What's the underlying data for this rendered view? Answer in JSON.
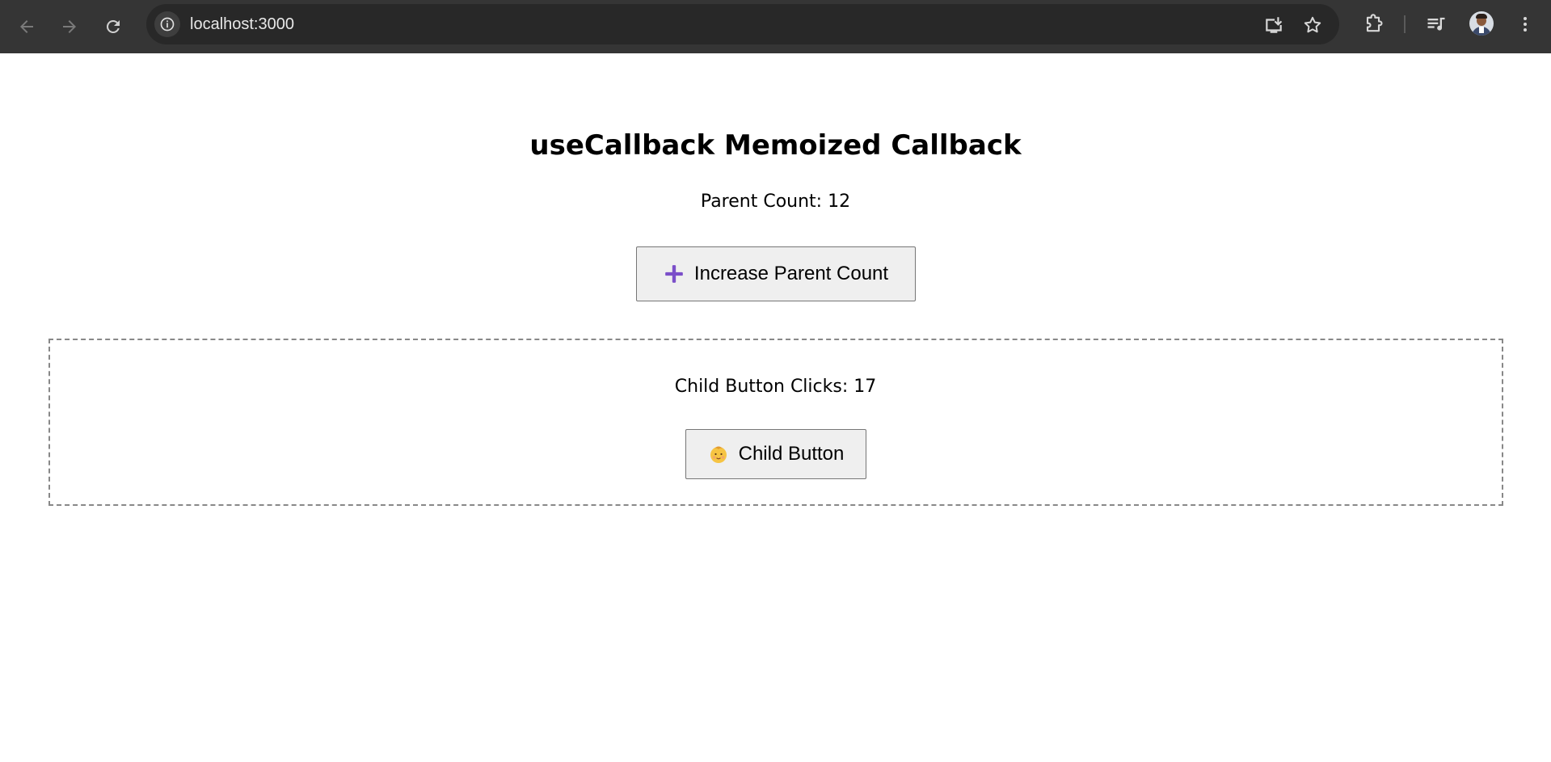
{
  "browser": {
    "url": "localhost:3000",
    "icons": {
      "back": "arrow-left-icon",
      "forward": "arrow-right-icon",
      "reload": "reload-icon",
      "site_info": "info-icon",
      "install": "install-app-icon",
      "bookmark": "star-icon",
      "extensions": "puzzle-icon",
      "media": "media-queue-icon",
      "profile": "avatar",
      "menu": "kebab-menu-icon"
    }
  },
  "page": {
    "title": "useCallback Memoized Callback",
    "parent_count": "Parent Count: 12",
    "increase_button_label": "Increase Parent Count",
    "increase_icon": "plus-icon",
    "increase_icon_color": "#7b4fc9",
    "child": {
      "clicks": "Child Button Clicks: 17",
      "button_label": "Child Button",
      "button_icon": "baby-icon"
    }
  }
}
